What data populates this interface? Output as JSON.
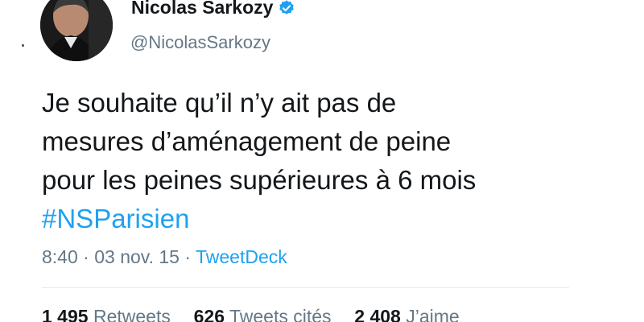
{
  "user": {
    "display_name": "Nicolas Sarkozy",
    "handle": "@NicolasSarkozy",
    "verified_icon": "verified-badge-icon"
  },
  "tweet": {
    "lines": [
      "Je souhaite qu’il n’y ait pas de",
      "mesures d’aménagement de peine",
      "pour les peines supérieures à 6 mois"
    ],
    "hashtag": "#NSParisien"
  },
  "meta": {
    "time": "8:40",
    "date": "03 nov. 15",
    "separator": "·",
    "source": "TweetDeck"
  },
  "stats": {
    "retweets_count": "1 495",
    "retweets_label": "Retweets",
    "quotes_count": "626",
    "quotes_label": "Tweets cités",
    "likes_count": "2 408",
    "likes_label": "J’aime"
  },
  "colors": {
    "link": "#1da1f2",
    "text": "#14171a",
    "muted": "#657786"
  }
}
